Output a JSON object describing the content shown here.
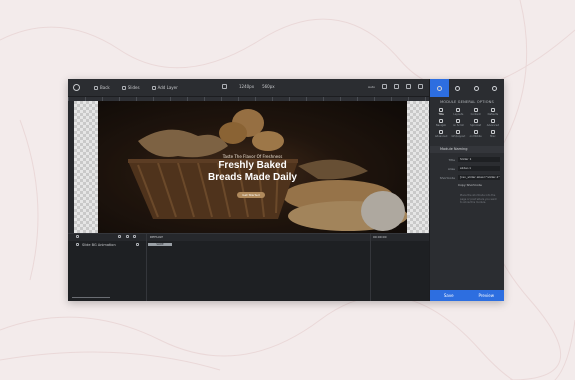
{
  "toolbar": {
    "back_label": "Back",
    "slides_label": "Slides",
    "add_layer_label": "Add Layer",
    "width_value": "1240px",
    "height_value": "560px",
    "mode_label": "Auto"
  },
  "slide": {
    "subtitle": "Taste The Flavor Of Freshness",
    "title_line1": "Freshly Baked",
    "title_line2": "Breads Made Daily",
    "button_label": "Get Started"
  },
  "timeline": {
    "layer_name": "Slide BG Animation",
    "tab_label": "DEFAULT",
    "bar_label": "SLIDE",
    "end_label": "00:00:00"
  },
  "panel": {
    "title": "MODULE GENERAL OPTIONS",
    "options": [
      "Title",
      "Layouts",
      "Content",
      "Defaults",
      "Navigat.",
      "on Scroll",
      "Sprocket",
      "Advanced",
      "Advanced",
      "Gfx/Layout",
      "on Mobile",
      "Misc"
    ],
    "section_label": "Module Naming",
    "title_field_label": "Title",
    "title_field_value": "Slider 1",
    "alias_field_label": "Alias",
    "alias_field_value": "slider-1",
    "shortcode_label": "Shortcode",
    "shortcode_value": "[rev_slider alias=\"slider-1\"]",
    "copy_label": "Copy Shortcode",
    "note": "Place the shortcode into the page or post where you want to show this module.",
    "save_label": "Save",
    "preview_label": "Preview"
  }
}
